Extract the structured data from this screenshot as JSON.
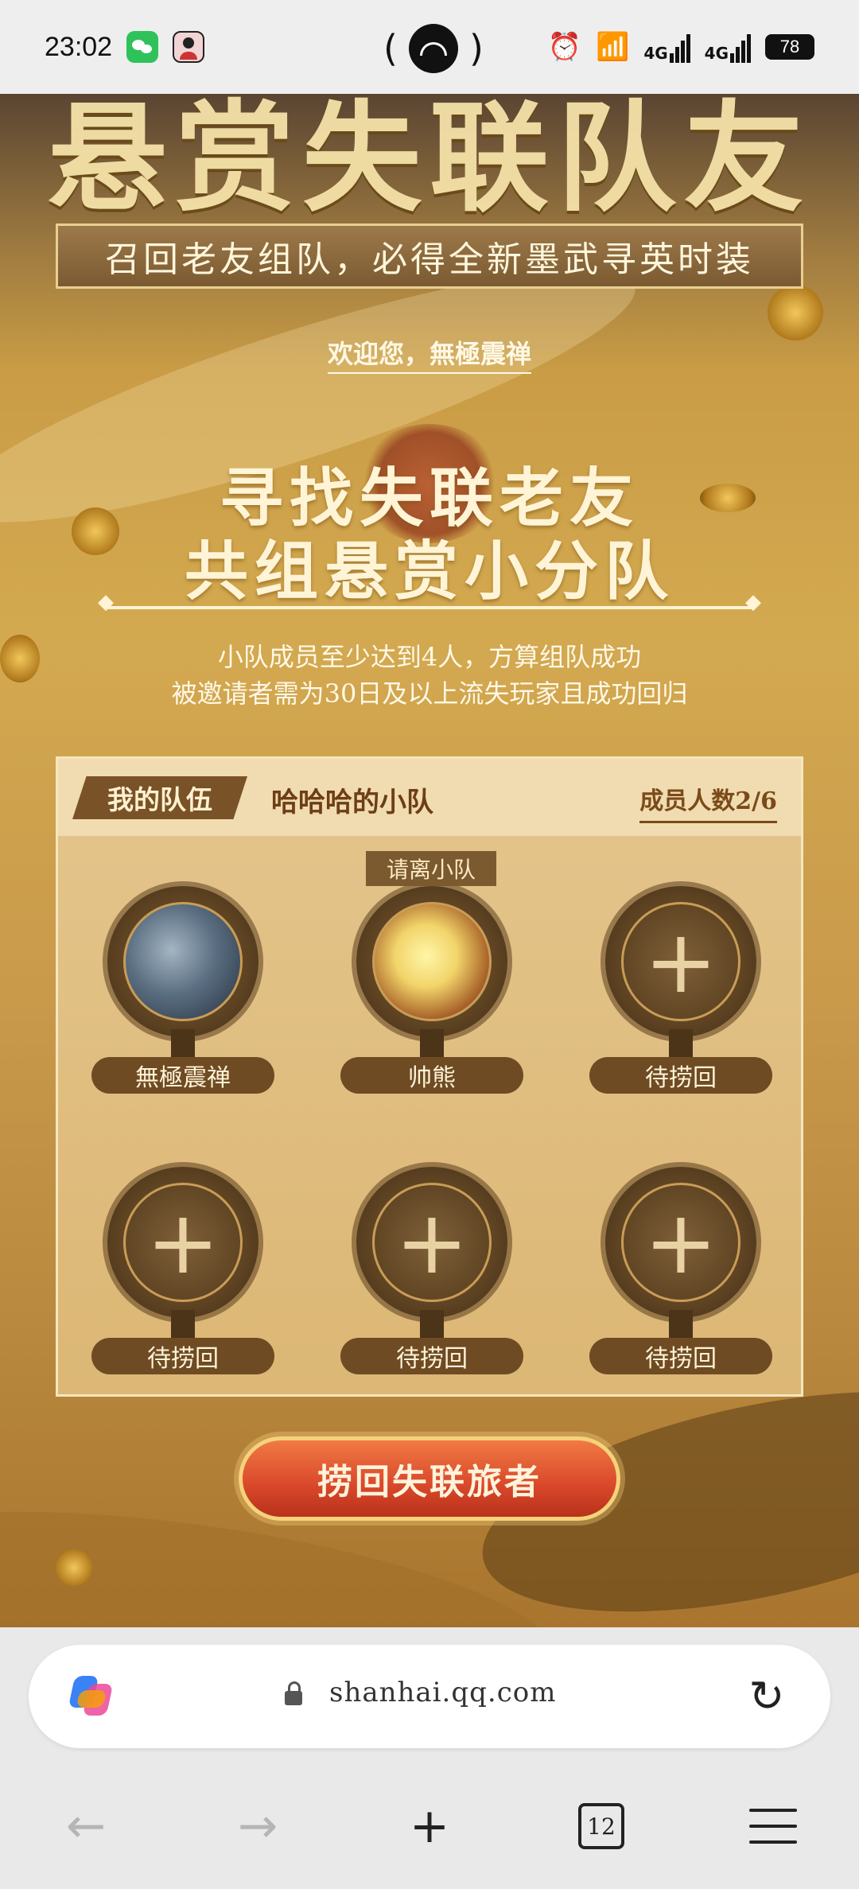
{
  "status_bar": {
    "time": "23:02",
    "pill_left": "(",
    "pill_right": ")",
    "net1": "4G",
    "net2": "4G",
    "battery": "78"
  },
  "page": {
    "banner_subtitle": "召回老友组队，必得全新墨武寻英时装",
    "welcome": "欢迎您，無極震禅",
    "headline_line1": "寻找失联老友",
    "headline_line2": "共组悬赏小分队",
    "sub_line1": "小队成员至少达到4人，方算组队成功",
    "sub_line2": "被邀请者需为30日及以上流失玩家且成功回归"
  },
  "team": {
    "tab_label": "我的队伍",
    "team_name": "哈哈哈的小队",
    "member_count": "成员人数2/6",
    "leave_label": "请离小队",
    "slots": [
      {
        "name": "無極震禅",
        "type": "member"
      },
      {
        "name": "帅熊",
        "type": "member"
      },
      {
        "name": "待捞回",
        "type": "empty"
      },
      {
        "name": "待捞回",
        "type": "empty"
      },
      {
        "name": "待捞回",
        "type": "empty"
      },
      {
        "name": "待捞回",
        "type": "empty"
      }
    ]
  },
  "cta_label": "捞回失联旅者",
  "browser": {
    "url": "shanhai.qq.com",
    "tab_count": "12"
  }
}
